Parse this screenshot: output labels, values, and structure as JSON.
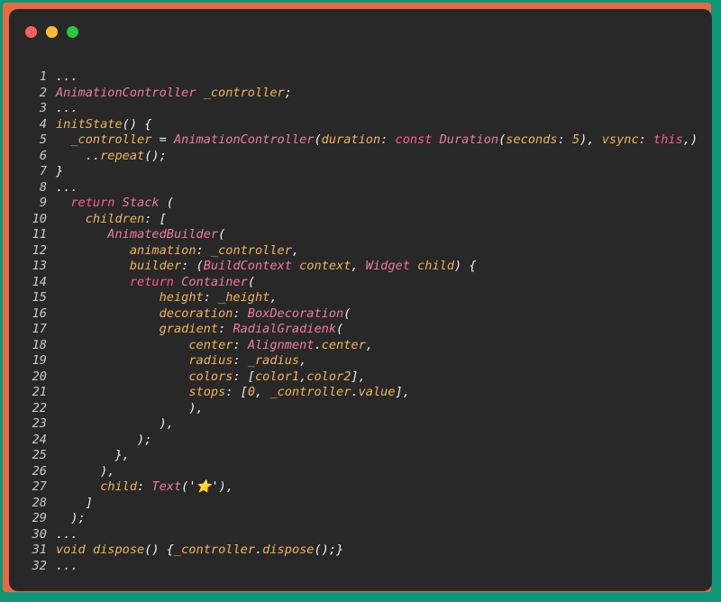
{
  "window": {
    "controls": [
      {
        "name": "close-dot",
        "color": "#ff5f56"
      },
      {
        "name": "minimize-dot",
        "color": "#ffbd2e"
      },
      {
        "name": "maximize-dot",
        "color": "#27c93f"
      }
    ]
  },
  "code": {
    "lines": [
      {
        "num": "1",
        "tokens": [
          [
            "p",
            "..."
          ]
        ]
      },
      {
        "num": "2",
        "tokens": [
          [
            "t",
            "AnimationController"
          ],
          [
            "p",
            " "
          ],
          [
            "n",
            "_controller"
          ],
          [
            "p",
            ";"
          ]
        ]
      },
      {
        "num": "3",
        "tokens": [
          [
            "p",
            "..."
          ]
        ]
      },
      {
        "num": "4",
        "tokens": [
          [
            "n",
            "initState"
          ],
          [
            "p",
            "() {"
          ]
        ]
      },
      {
        "num": "5",
        "tokens": [
          [
            "n",
            "  _controller"
          ],
          [
            "p",
            " = "
          ],
          [
            "t",
            "AnimationController"
          ],
          [
            "p",
            "("
          ],
          [
            "n",
            "duration"
          ],
          [
            "p",
            ": "
          ],
          [
            "k",
            "const"
          ],
          [
            "p",
            " "
          ],
          [
            "t",
            "Duration"
          ],
          [
            "p",
            "("
          ],
          [
            "n",
            "seconds"
          ],
          [
            "p",
            ": "
          ],
          [
            "n",
            "5"
          ],
          [
            "p",
            "), "
          ],
          [
            "n",
            "vsync"
          ],
          [
            "p",
            ": "
          ],
          [
            "k",
            "this"
          ],
          [
            "p",
            ",)"
          ]
        ]
      },
      {
        "num": "6",
        "tokens": [
          [
            "p",
            "    .."
          ],
          [
            "n",
            "repeat"
          ],
          [
            "p",
            "();"
          ]
        ]
      },
      {
        "num": "7",
        "tokens": [
          [
            "p",
            "}"
          ]
        ]
      },
      {
        "num": "8",
        "tokens": [
          [
            "p",
            "..."
          ]
        ]
      },
      {
        "num": "9",
        "tokens": [
          [
            "p",
            "  "
          ],
          [
            "k",
            "return"
          ],
          [
            "p",
            " "
          ],
          [
            "t",
            "Stack"
          ],
          [
            "p",
            " ("
          ]
        ]
      },
      {
        "num": "10",
        "tokens": [
          [
            "p",
            "    "
          ],
          [
            "n",
            "children"
          ],
          [
            "p",
            ": ["
          ]
        ]
      },
      {
        "num": "11",
        "tokens": [
          [
            "p",
            "       "
          ],
          [
            "t",
            "AnimatedBuilder"
          ],
          [
            "p",
            "("
          ]
        ]
      },
      {
        "num": "12",
        "tokens": [
          [
            "p",
            "          "
          ],
          [
            "n",
            "animation"
          ],
          [
            "p",
            ": "
          ],
          [
            "n",
            "_controller"
          ],
          [
            "p",
            ","
          ]
        ]
      },
      {
        "num": "13",
        "tokens": [
          [
            "p",
            "          "
          ],
          [
            "n",
            "builder"
          ],
          [
            "p",
            ": ("
          ],
          [
            "t",
            "BuildContext"
          ],
          [
            "p",
            " "
          ],
          [
            "n",
            "context"
          ],
          [
            "p",
            ", "
          ],
          [
            "t",
            "Widget"
          ],
          [
            "p",
            " "
          ],
          [
            "n",
            "child"
          ],
          [
            "p",
            ") {"
          ]
        ]
      },
      {
        "num": "14",
        "tokens": [
          [
            "p",
            "          "
          ],
          [
            "k",
            "return"
          ],
          [
            "p",
            " "
          ],
          [
            "t",
            "Container"
          ],
          [
            "p",
            "("
          ]
        ]
      },
      {
        "num": "15",
        "tokens": [
          [
            "p",
            "              "
          ],
          [
            "n",
            "height"
          ],
          [
            "p",
            ": "
          ],
          [
            "n",
            "_height"
          ],
          [
            "p",
            ","
          ]
        ]
      },
      {
        "num": "16",
        "tokens": [
          [
            "p",
            "              "
          ],
          [
            "n",
            "decoration"
          ],
          [
            "p",
            ": "
          ],
          [
            "t",
            "BoxDecoration"
          ],
          [
            "p",
            "("
          ]
        ]
      },
      {
        "num": "17",
        "tokens": [
          [
            "p",
            "              "
          ],
          [
            "n",
            "gradient"
          ],
          [
            "p",
            ": "
          ],
          [
            "t",
            "RadialGradienk"
          ],
          [
            "p",
            "("
          ]
        ]
      },
      {
        "num": "18",
        "tokens": [
          [
            "p",
            "                  "
          ],
          [
            "n",
            "center"
          ],
          [
            "p",
            ": "
          ],
          [
            "t",
            "Alignment"
          ],
          [
            "p",
            "."
          ],
          [
            "n",
            "center"
          ],
          [
            "p",
            ","
          ]
        ]
      },
      {
        "num": "19",
        "tokens": [
          [
            "p",
            "                  "
          ],
          [
            "n",
            "radius"
          ],
          [
            "p",
            ": "
          ],
          [
            "n",
            "_radius"
          ],
          [
            "p",
            ","
          ]
        ]
      },
      {
        "num": "20",
        "tokens": [
          [
            "p",
            "                  "
          ],
          [
            "n",
            "colors"
          ],
          [
            "p",
            ": ["
          ],
          [
            "n",
            "color1"
          ],
          [
            "p",
            ","
          ],
          [
            "n",
            "color2"
          ],
          [
            "p",
            "],"
          ]
        ]
      },
      {
        "num": "21",
        "tokens": [
          [
            "p",
            "                  "
          ],
          [
            "n",
            "stops"
          ],
          [
            "p",
            ": ["
          ],
          [
            "n",
            "0"
          ],
          [
            "p",
            ", "
          ],
          [
            "n",
            "_controller"
          ],
          [
            "p",
            "."
          ],
          [
            "n",
            "value"
          ],
          [
            "p",
            "],"
          ]
        ]
      },
      {
        "num": "22",
        "tokens": [
          [
            "p",
            "                  ),"
          ]
        ]
      },
      {
        "num": "23",
        "tokens": [
          [
            "p",
            "              ),"
          ]
        ]
      },
      {
        "num": "24",
        "tokens": [
          [
            "p",
            "           );"
          ]
        ]
      },
      {
        "num": "25",
        "tokens": [
          [
            "p",
            "        },"
          ]
        ]
      },
      {
        "num": "26",
        "tokens": [
          [
            "p",
            "      ),"
          ]
        ]
      },
      {
        "num": "27",
        "tokens": [
          [
            "p",
            "      "
          ],
          [
            "n",
            "child"
          ],
          [
            "p",
            ": "
          ],
          [
            "t",
            "Text"
          ],
          [
            "p",
            "('"
          ],
          [
            "n",
            "⭐"
          ],
          [
            "p",
            "'),"
          ]
        ]
      },
      {
        "num": "28",
        "tokens": [
          [
            "p",
            "    ]"
          ]
        ]
      },
      {
        "num": "29",
        "tokens": [
          [
            "p",
            "  );"
          ]
        ]
      },
      {
        "num": "30",
        "tokens": [
          [
            "p",
            "..."
          ]
        ]
      },
      {
        "num": "31",
        "tokens": [
          [
            "n",
            "void"
          ],
          [
            "p",
            " "
          ],
          [
            "n",
            "dispose"
          ],
          [
            "p",
            "() {"
          ],
          [
            "n",
            "_controller"
          ],
          [
            "p",
            "."
          ],
          [
            "n",
            "dispose"
          ],
          [
            "p",
            "();}"
          ]
        ]
      },
      {
        "num": "32",
        "tokens": [
          [
            "p",
            "..."
          ]
        ]
      }
    ]
  }
}
